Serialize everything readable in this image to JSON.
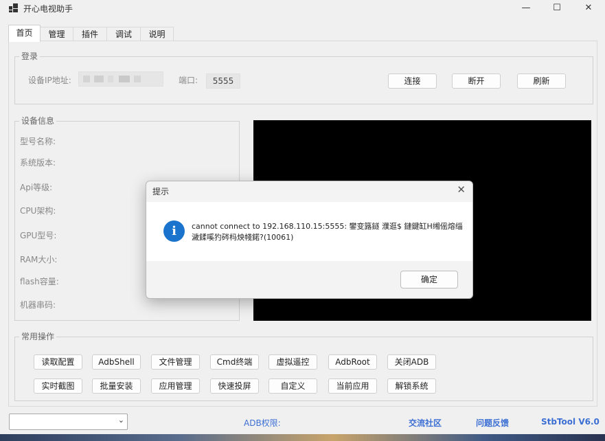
{
  "window": {
    "title": "开心电视助手",
    "controls": {
      "minimize": "—",
      "maximize": "☐",
      "close": "✕"
    }
  },
  "tabs": [
    "首页",
    "管理",
    "插件",
    "调试",
    "说明"
  ],
  "login": {
    "group_title": "登录",
    "ip_label": "设备IP地址:",
    "ip_value": "",
    "port_label": "端口:",
    "port_value": "5555",
    "connect": "连接",
    "disconnect": "断开",
    "refresh": "刷新"
  },
  "device_info": {
    "group_title": "设备信息",
    "fields": [
      "型号名称:",
      "系统版本:",
      "Api等级:",
      "CPU架构:",
      "GPU型号:",
      "RAM大小:",
      "flash容量:",
      "机器串码:"
    ]
  },
  "common_ops": {
    "group_title": "常用操作",
    "row1": [
      "读取配置",
      "AdbShell",
      "文件管理",
      "Cmd终端",
      "虚拟遥控",
      "AdbRoot",
      "关闭ADB"
    ],
    "row2": [
      "实时截图",
      "批量安装",
      "应用管理",
      "快速投屏",
      "自定义",
      "当前应用",
      "解锁系统"
    ]
  },
  "dialog": {
    "title": "提示",
    "icon": "i",
    "message": "cannot connect to 192.168.110.15:5555: 鐢变簬鐩    濮逛$ 鏈鍵缸H缃傜熔缁濊鍒嗘犳硶杩炴帴鍩?(10061)",
    "ok": "确定"
  },
  "status": {
    "adb_label": "ADB权限:",
    "community": "交流社区",
    "feedback": "问题反馈",
    "version": "StbTool V6.0"
  },
  "colors": {
    "link": "#3c6fd4",
    "info_icon": "#1a73cc",
    "screen": "#000000"
  }
}
